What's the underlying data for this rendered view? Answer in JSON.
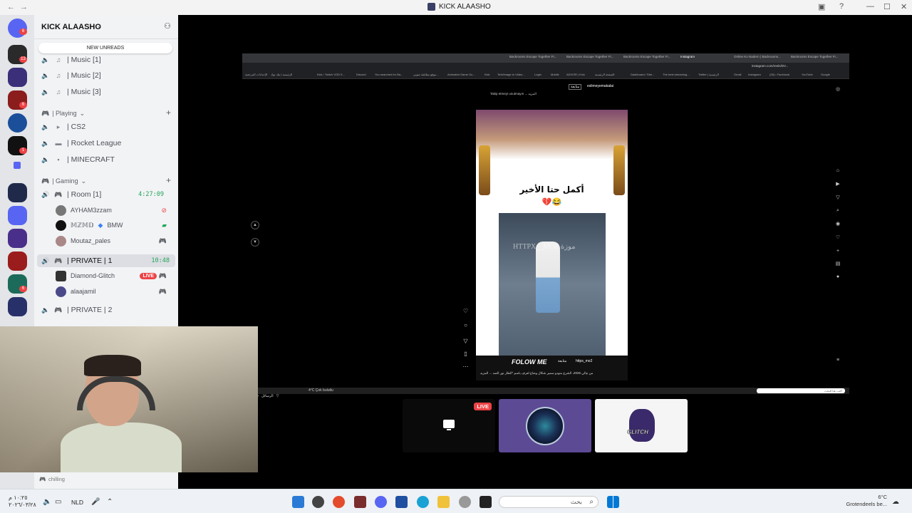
{
  "window": {
    "title": "KICK ALAASHO",
    "back": "←",
    "forward": "→",
    "controls": {
      "minimize": "—",
      "maximize": "☐",
      "close": "✕",
      "help": "?",
      "inbox": "▣"
    }
  },
  "server_rail": {
    "home_badge": "6",
    "badges": [
      "13",
      "6",
      "1",
      "6"
    ]
  },
  "sidebar": {
    "server_name": "KICK ALAASHO",
    "new_unreads": "NEW UNREADS",
    "music_channels": [
      "| Music [1]",
      "| Music [2]",
      "| Music [3]"
    ],
    "playing_category": "| Playing",
    "playing_channels": [
      "| CS2",
      "| Rocket League",
      "| MINECRAFT"
    ],
    "gaming_category": "| Gaming",
    "room_channel": "| Room [1]",
    "room_timer": "4:27:09",
    "room_users": [
      "AYHAM3zzam",
      "𝕄ℤ𝕄𝔻",
      "BMW",
      "Moutaz_pales"
    ],
    "private_channel": "| PRIVATE | 1",
    "private_timer": "10:48",
    "private_users": [
      "Diamond-Glitch",
      "alaajamil"
    ],
    "live_label": "LIVE",
    "private2_channel": "| PRIVATE | 2",
    "status_text": "chilling"
  },
  "stream": {
    "url": "instagram.com/reels/DV...",
    "tabs": [
      "Backrooms Escape Together Fr...",
      "Backrooms Escape Together Fr...",
      "Backrooms Escape Together Fr...",
      "Instagram",
      "Online Ko Nadern | Backrooms...",
      "Backrooms Escape Together Fr..."
    ],
    "bookmarks": [
      "الإعدادات المرجعية",
      "الرئيسية | تيك توك",
      "Kick / Twitch VOD K...",
      "Discord",
      "You searched for Ba...",
      "موقع مطابقة صوتي...",
      "Animated Game Gu...",
      "Kick",
      "Text/Image to Video...",
      "Login",
      "Mobile",
      "ADVISR | Kick",
      "الصفحة الرئيسية",
      "Dashboard / Stre...",
      "The best streaming...",
      "Twitter | الرئيسية",
      "Gmail",
      "Instagram",
      "(28) • Facebook",
      "YouTube",
      "Google"
    ],
    "post_username": "eslimeyemakalai",
    "post_follow": "متابعة",
    "post_follow_text": "Takip etmeyi unutmayın ... المزيد",
    "post_arabic": "أكمل حتا الأخير",
    "post_emoji": "💔😂",
    "post_watermark": "HTTPX__MOZ موزة",
    "post_bottom_text": "FOLOW ME",
    "post_bottom_user": "https_mo2",
    "post_caption": "من نيالي 2026، الشرع منودو سمير شكال وضاع لعرف باسم \"الطار نور الصد ... المزيد",
    "messages_label": "الرسائل",
    "weather": "4°C Çok bulutlu",
    "search_placeholder": "اكتب هنا للبحث"
  },
  "tiles": {
    "live_label": "LIVE",
    "wolf_text": "GLITCH"
  },
  "taskbar": {
    "time": "١٠:٢٥ م",
    "date": "٢٠٢٦/٠٣/٢٨",
    "language": "NLD",
    "search_placeholder": "بحث",
    "weather_temp": "6°C",
    "weather_desc": "Grotendeels be..."
  }
}
